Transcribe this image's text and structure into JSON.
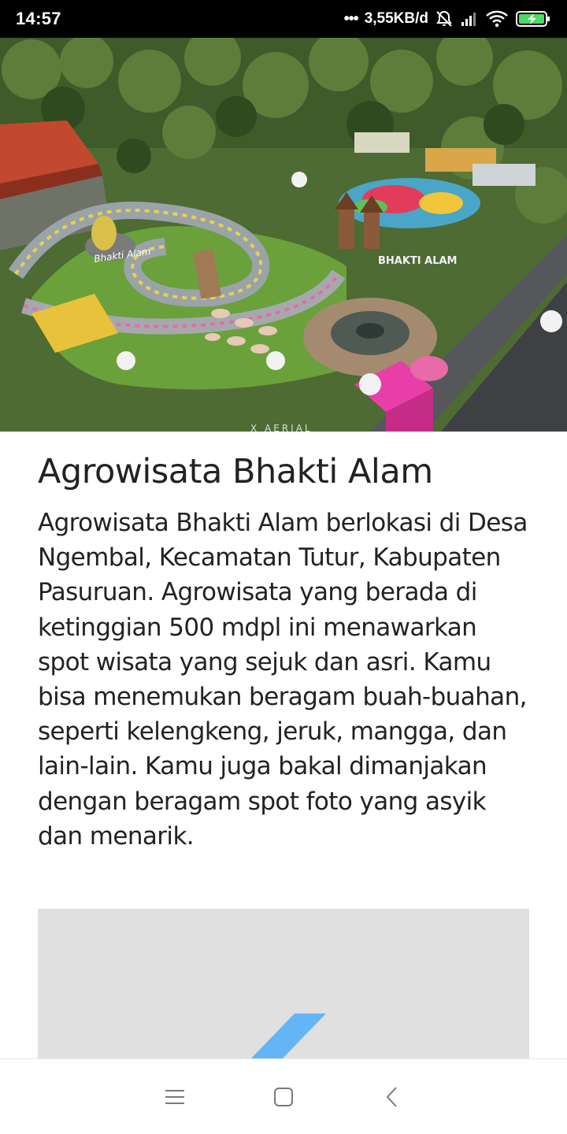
{
  "status_bar": {
    "time": "14:57",
    "network_speed": "3,55KB/d",
    "icons": [
      "more-dots-icon",
      "alarm-off-icon",
      "signal-icon",
      "wifi-icon",
      "battery-charging-icon"
    ]
  },
  "hero": {
    "image_alt": "Aerial view of Agrowisata Bhakti Alam park",
    "sign_text_1": "Bhakti Alam",
    "sign_text_2": "BHAKTI ALAM",
    "watermark": "X AERIAL"
  },
  "article": {
    "title": "Agrowisata Bhakti Alam",
    "body": "Agrowisata Bhakti Alam berlokasi di Desa Ngembal, Kecamatan Tutur, Kabupaten Pasuruan. Agrowisata yang berada di ketinggian 500 mdpl ini menawarkan spot wisata yang sejuk dan asri. Kamu bisa menemukan beragam buah-buahan, seperti kelengkeng, jeruk, mangga, dan lain-lain. Kamu juga bakal dimanjakan dengan beragam spot foto yang asyik dan menarik."
  },
  "colors": {
    "text": "#222222",
    "placeholder_bg": "#e0e0e0",
    "loader_accent": "#64b5f6",
    "status_bg": "#000000",
    "battery_green": "#4cd964"
  },
  "nav": {
    "icons": [
      "menu-icon",
      "home-icon",
      "back-icon"
    ]
  }
}
